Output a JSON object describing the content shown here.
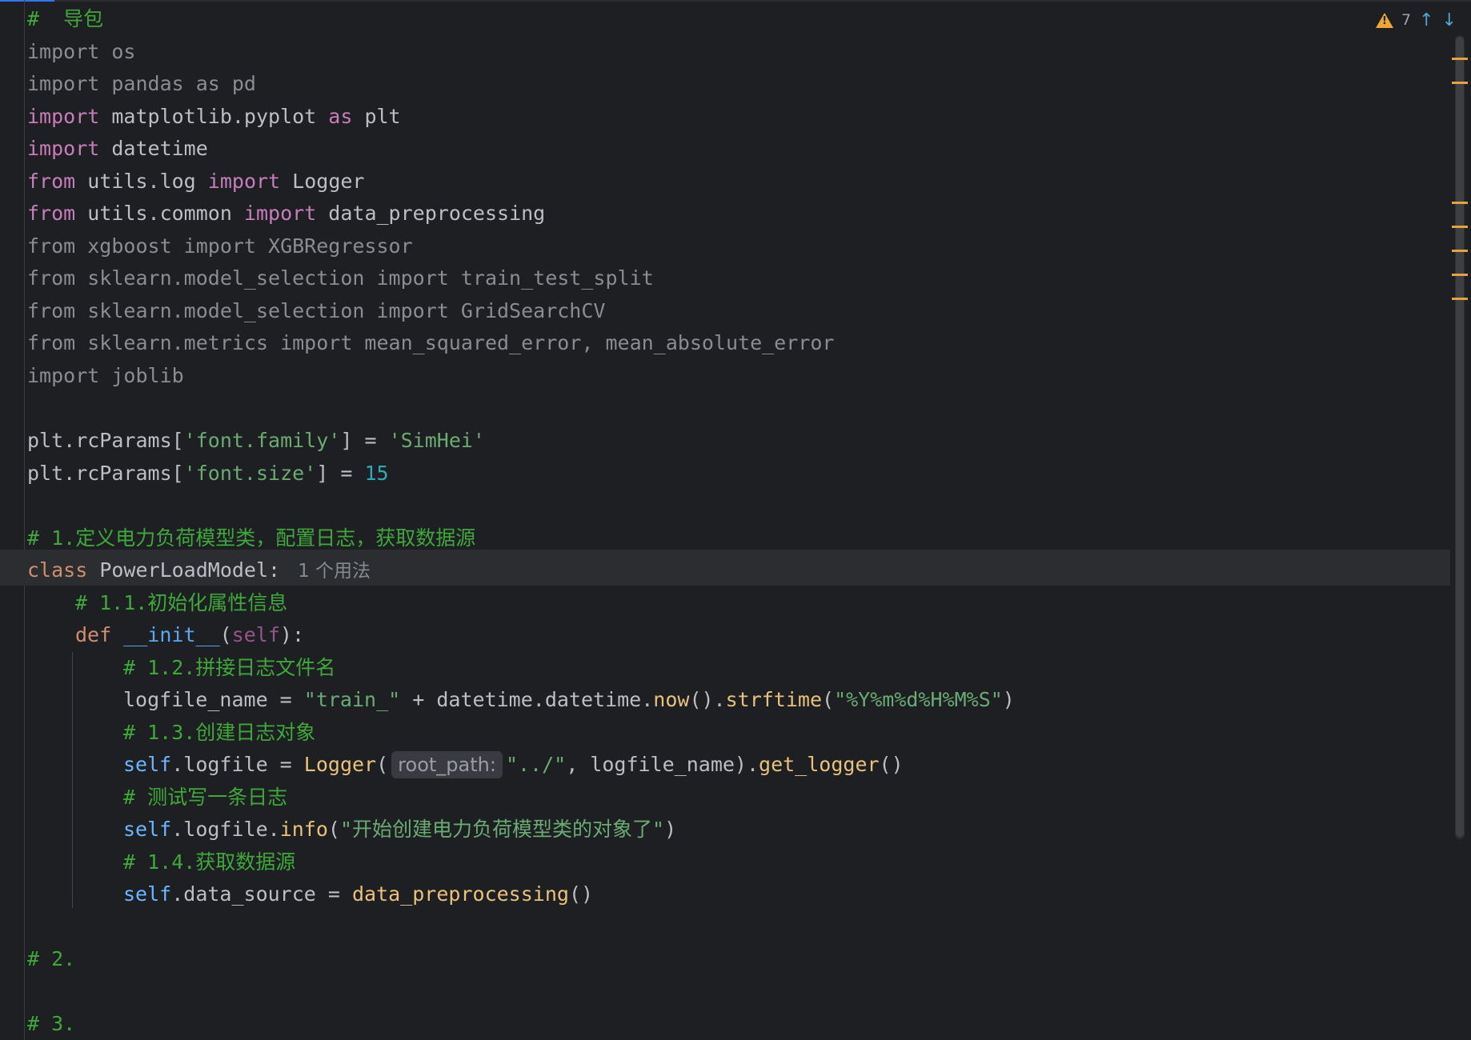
{
  "inspection": {
    "warning_count": "7"
  },
  "code": {
    "l1_comment": "#  导包",
    "l2": "import os",
    "l3": "import pandas as pd",
    "l4_kw": "import",
    "l4_mid": " matplotlib.pyplot ",
    "l4_as": "as",
    "l4_end": " plt",
    "l5_kw": "import",
    "l5_end": " datetime",
    "l6_from": "from",
    "l6_mid": " utils.log ",
    "l6_imp": "import",
    "l6_end": " Logger",
    "l7_from": "from",
    "l7_mid": " utils.common ",
    "l7_imp": "import",
    "l7_end": " data_preprocessing",
    "l8": "from xgboost import XGBRegressor",
    "l9": "from sklearn.model_selection import train_test_split",
    "l10": "from sklearn.model_selection import GridSearchCV",
    "l11": "from sklearn.metrics import mean_squared_error, mean_absolute_error",
    "l12": "import joblib",
    "l14_a": "plt.rcParams[",
    "l14_s": "'font.family'",
    "l14_b": "] = ",
    "l14_v": "'SimHei'",
    "l15_a": "plt.rcParams[",
    "l15_s": "'font.size'",
    "l15_b": "] = ",
    "l15_v": "15",
    "l17_comment": "# 1.定义电力负荷模型类，配置日志，获取数据源",
    "l18_kw": "class",
    "l18_name": " PowerLoadModel:",
    "l18_usage": "1 个用法",
    "l19_comment": "# 1.1.初始化属性信息",
    "l20_kw": "def",
    "l20_name": " __init__",
    "l20_p1": "(",
    "l20_self": "self",
    "l20_p2": "):",
    "l21_comment": "# 1.2.拼接日志文件名",
    "l22_a": "logfile_name = ",
    "l22_s1": "\"train_\"",
    "l22_b": " + datetime.datetime.",
    "l22_fn1": "now",
    "l22_c": "().",
    "l22_fn2": "strftime",
    "l22_d": "(",
    "l22_s2": "\"%Y%m%d%H%M%S\"",
    "l22_e": ")",
    "l23_comment": "# 1.3.创建日志对象",
    "l24_self": "self",
    "l24_a": ".logfile = ",
    "l24_fn": "Logger",
    "l24_b": "(",
    "l24_hint": "root_path:",
    "l24_s": "\"../\"",
    "l24_c": ", logfile_name).",
    "l24_fn2": "get_logger",
    "l24_d": "()",
    "l25_comment": "# 测试写一条日志",
    "l26_self": "self",
    "l26_a": ".logfile.",
    "l26_fn": "info",
    "l26_b": "(",
    "l26_s": "\"开始创建电力负荷模型类的对象了\"",
    "l26_c": ")",
    "l27_comment": "# 1.4.获取数据源",
    "l28_self": "self",
    "l28_a": ".data_source = ",
    "l28_fn": "data_preprocessing",
    "l28_b": "()",
    "l30_comment": "# 2.",
    "l32_comment": "# 3."
  }
}
